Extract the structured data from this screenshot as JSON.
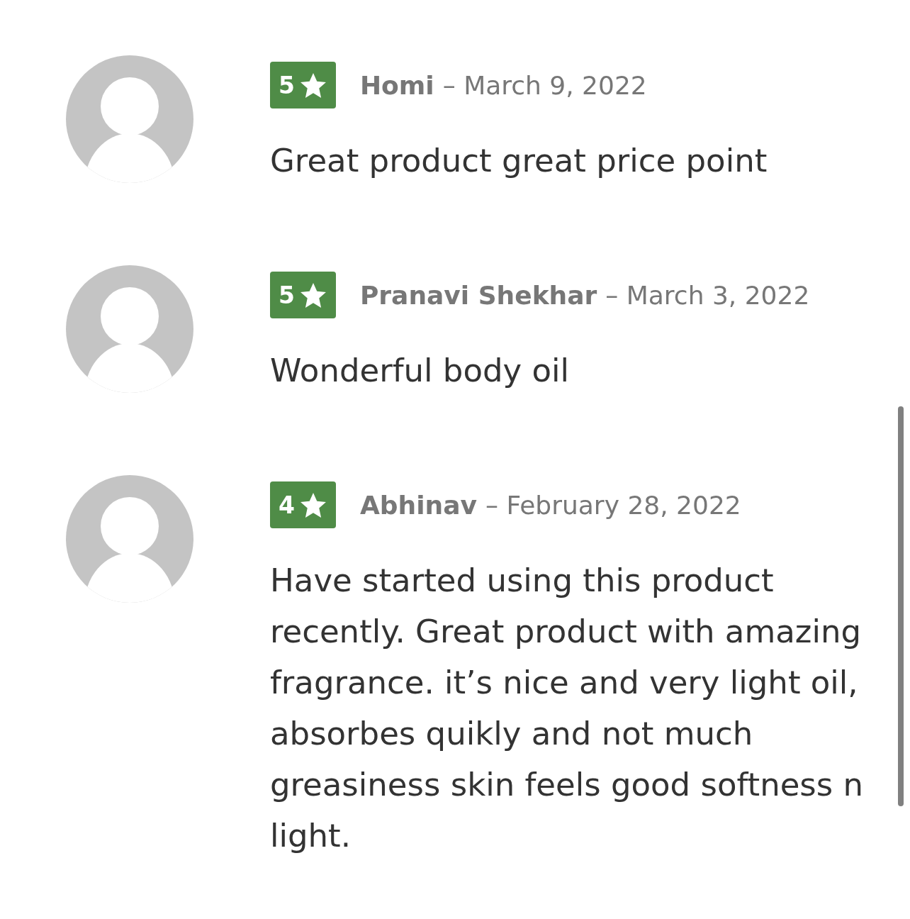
{
  "reviews": [
    {
      "rating": "5",
      "author": "Homi",
      "date": "– March 9, 2022",
      "text": "Great product great price point"
    },
    {
      "rating": "5",
      "author": "Pranavi Shekhar",
      "date": "– March 3, 2022",
      "text": "Wonderful body oil"
    },
    {
      "rating": "4",
      "author": "Abhinav",
      "date": "– February 28, 2022",
      "text": "Have started using this product recently. Great product with amazing fragrance. it’s nice and very light oil, absorbes quikly and not much greasiness skin feels good softness n light."
    }
  ]
}
